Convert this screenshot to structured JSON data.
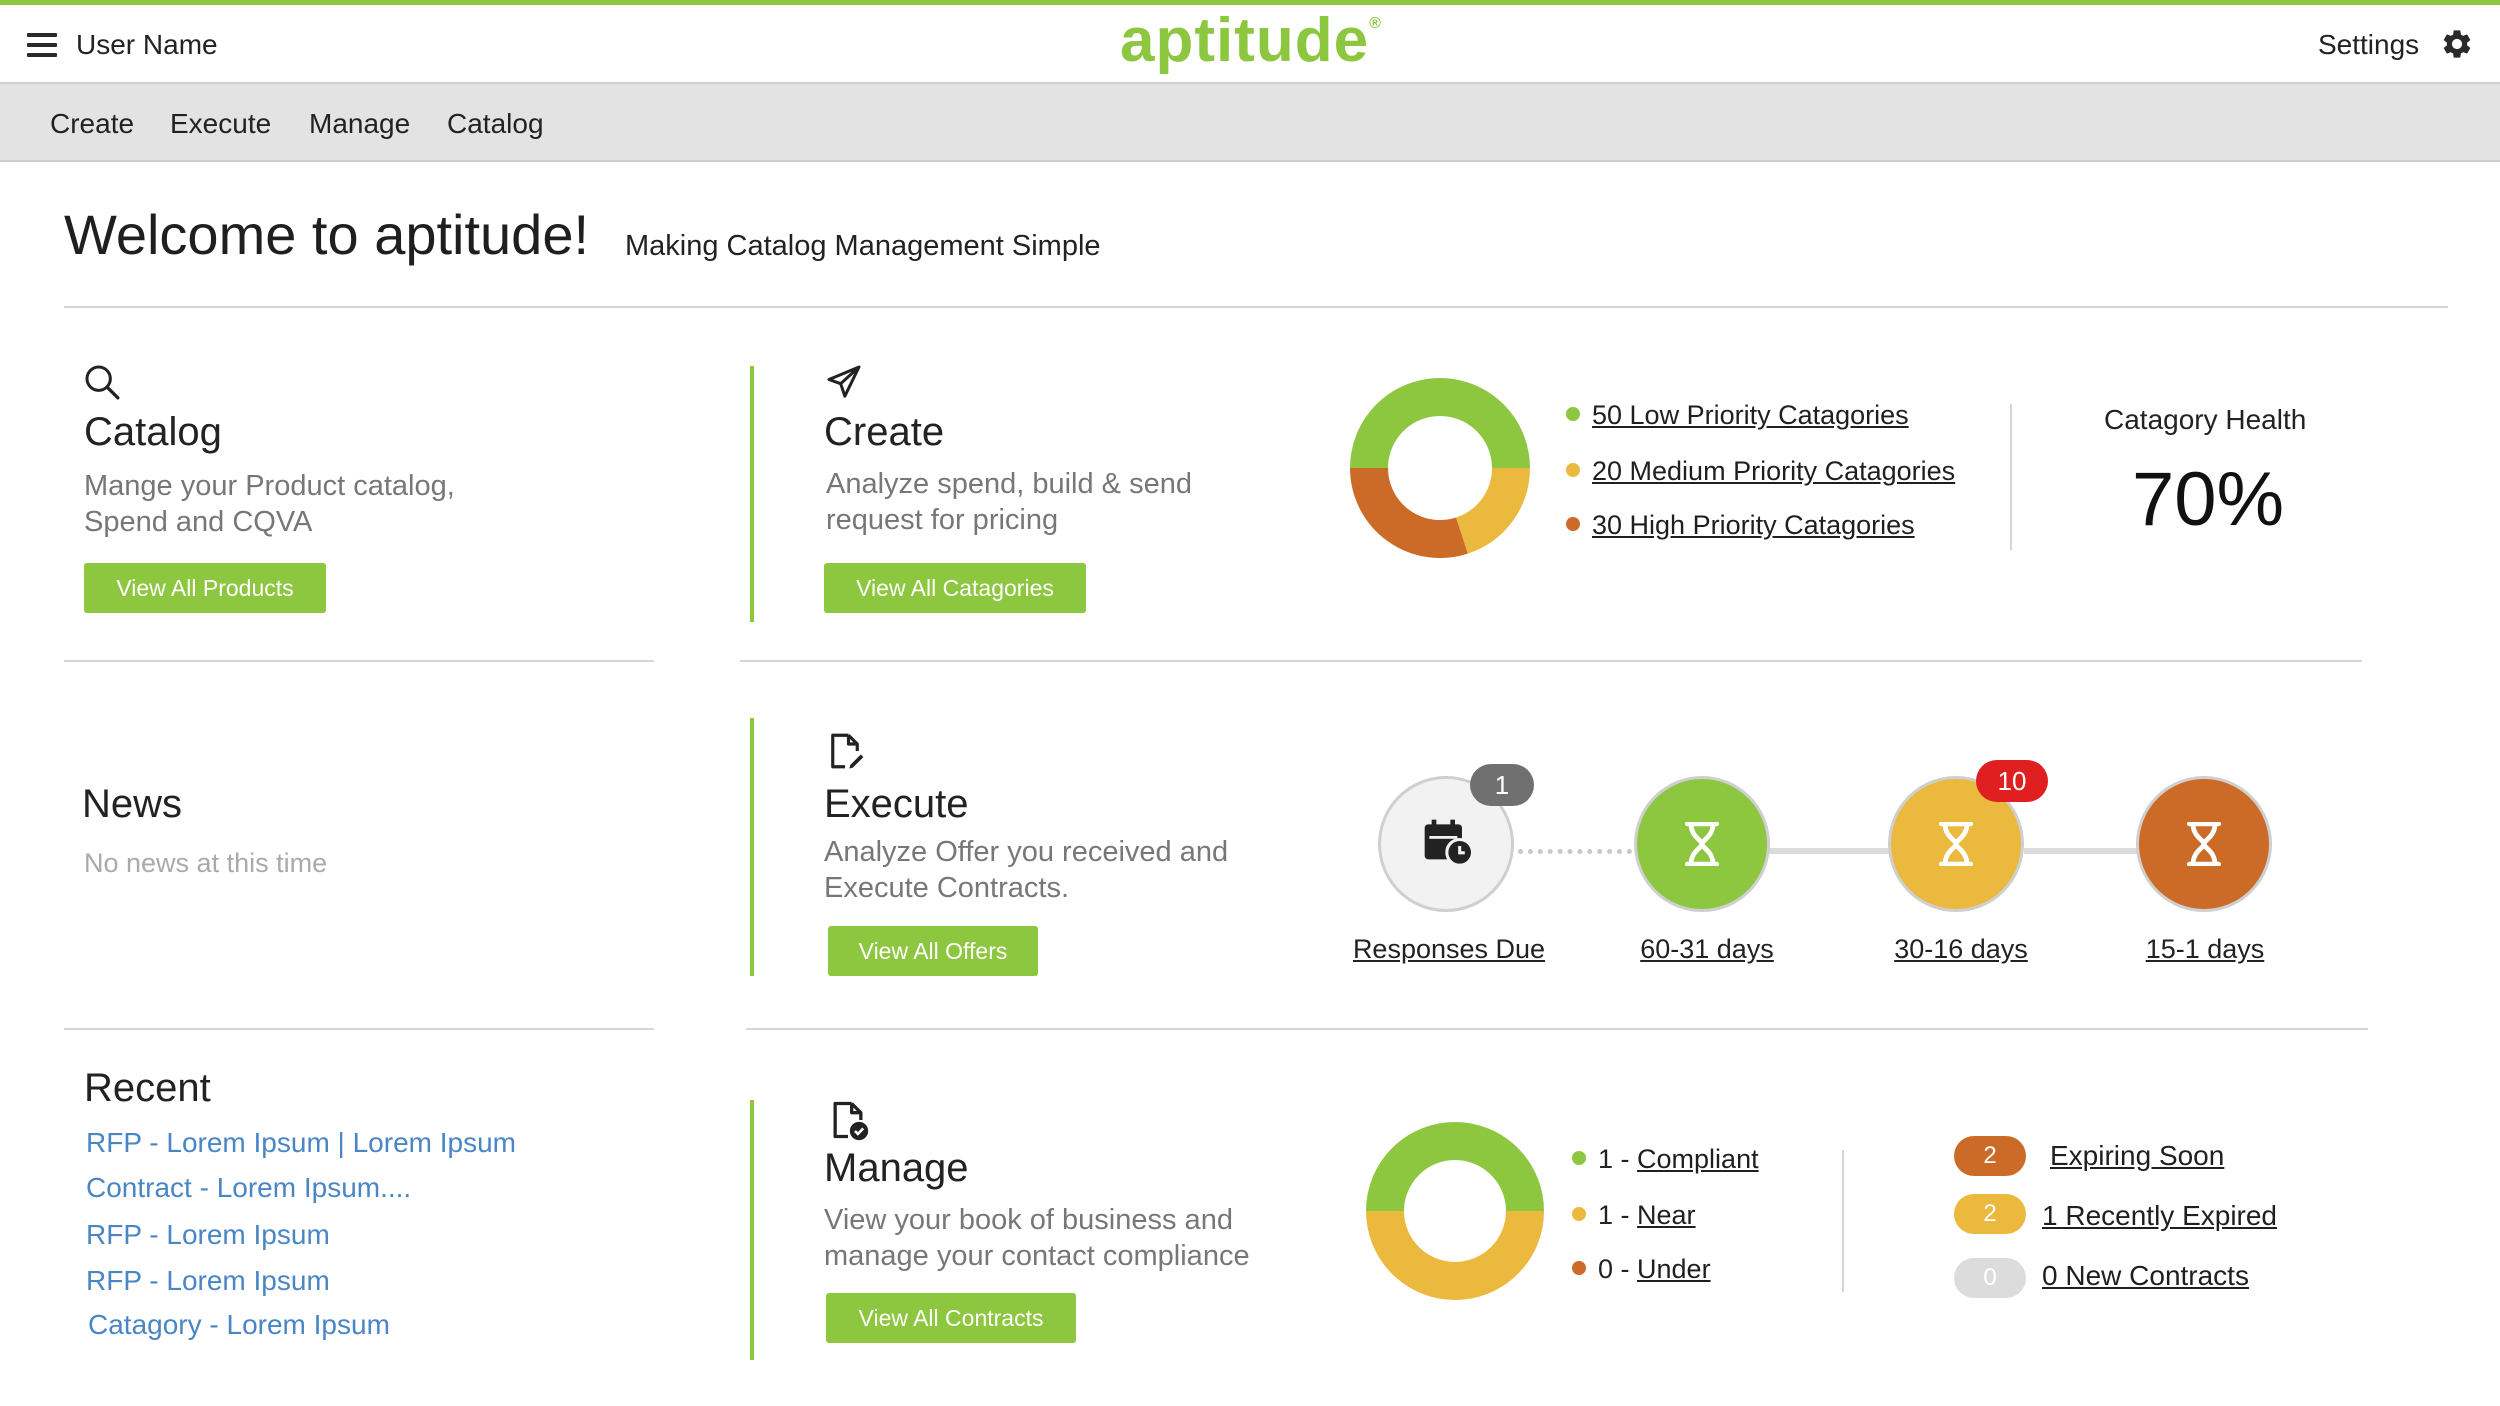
{
  "header": {
    "user_name": "User Name",
    "logo_text": "aptitude",
    "logo_mark": "®",
    "settings_label": "Settings",
    "menu_icon": "hamburger-icon",
    "settings_icon": "gear-icon"
  },
  "nav": {
    "items": [
      {
        "label": "Create"
      },
      {
        "label": "Execute"
      },
      {
        "label": "Manage"
      },
      {
        "label": "Catalog"
      }
    ]
  },
  "welcome": {
    "title": "Welcome to aptitude!",
    "tagline": "Making Catalog Management Simple"
  },
  "catalog": {
    "icon": "search-icon",
    "title": "Catalog",
    "desc_line1": "Mange your Product catalog,",
    "desc_line2": "Spend and CQVA",
    "button": "View All Products"
  },
  "news": {
    "title": "News",
    "empty": "No news at this time"
  },
  "recent": {
    "title": "Recent",
    "items": [
      "RFP - Lorem Ipsum | Lorem Ipsum",
      "Contract - Lorem Ipsum....",
      "RFP - Lorem Ipsum",
      "RFP - Lorem Ipsum",
      "Catagory - Lorem Ipsum"
    ]
  },
  "create": {
    "icon": "paper-plane-icon",
    "title": "Create",
    "desc_line1": "Analyze spend, build & send",
    "desc_line2": "request for pricing",
    "button": "View All Catagories",
    "priorities": [
      {
        "label": "50 Low Priority Catagories",
        "count": 50,
        "color": "#8dc63f"
      },
      {
        "label": "20 Medium Priority Catagories",
        "count": 20,
        "color": "#eab93e"
      },
      {
        "label": "30 High Priority Catagories",
        "count": 30,
        "color": "#cb6b27"
      }
    ],
    "health_label": "Catagory Health",
    "health_value": "70%"
  },
  "execute": {
    "icon": "document-edit-icon",
    "title": "Execute",
    "desc_line1": "Analyze Offer you received and",
    "desc_line2": "Execute Contracts.",
    "button": "View All Offers",
    "stages": [
      {
        "label": "Responses Due",
        "badge": "1",
        "icon": "calendar-clock-icon",
        "color": "#f2f2f2"
      },
      {
        "label": "60-31 days",
        "badge": "",
        "icon": "hourglass-icon",
        "color": "#8dc63f"
      },
      {
        "label": "30-16 days",
        "badge": "10",
        "icon": "hourglass-icon",
        "color": "#eab93e"
      },
      {
        "label": "15-1 days",
        "badge": "",
        "icon": "hourglass-icon",
        "color": "#cb6b27"
      }
    ]
  },
  "manage": {
    "icon": "document-check-icon",
    "title": "Manage",
    "desc_line1": "View your book of business and",
    "desc_line2": "manage your contact compliance",
    "button": "View All Contracts",
    "compliance": [
      {
        "count": "1",
        "sep": " - ",
        "label": "Compliant",
        "color": "#8dc63f",
        "value": 1
      },
      {
        "count": "1",
        "sep": " - ",
        "label": "Near",
        "color": "#eab93e",
        "value": 1
      },
      {
        "count": "0",
        "sep": " - ",
        "label": "Under",
        "color": "#cb6b27",
        "value": 0
      }
    ],
    "contracts": [
      {
        "badge": "2",
        "label": "Expiring Soon",
        "color": "#cb6b27"
      },
      {
        "badge": "2",
        "label": "1 Recently Expired",
        "color": "#eab93e"
      },
      {
        "badge": "0",
        "label": "0 New Contracts",
        "color": "#dcdcdc"
      }
    ]
  }
}
